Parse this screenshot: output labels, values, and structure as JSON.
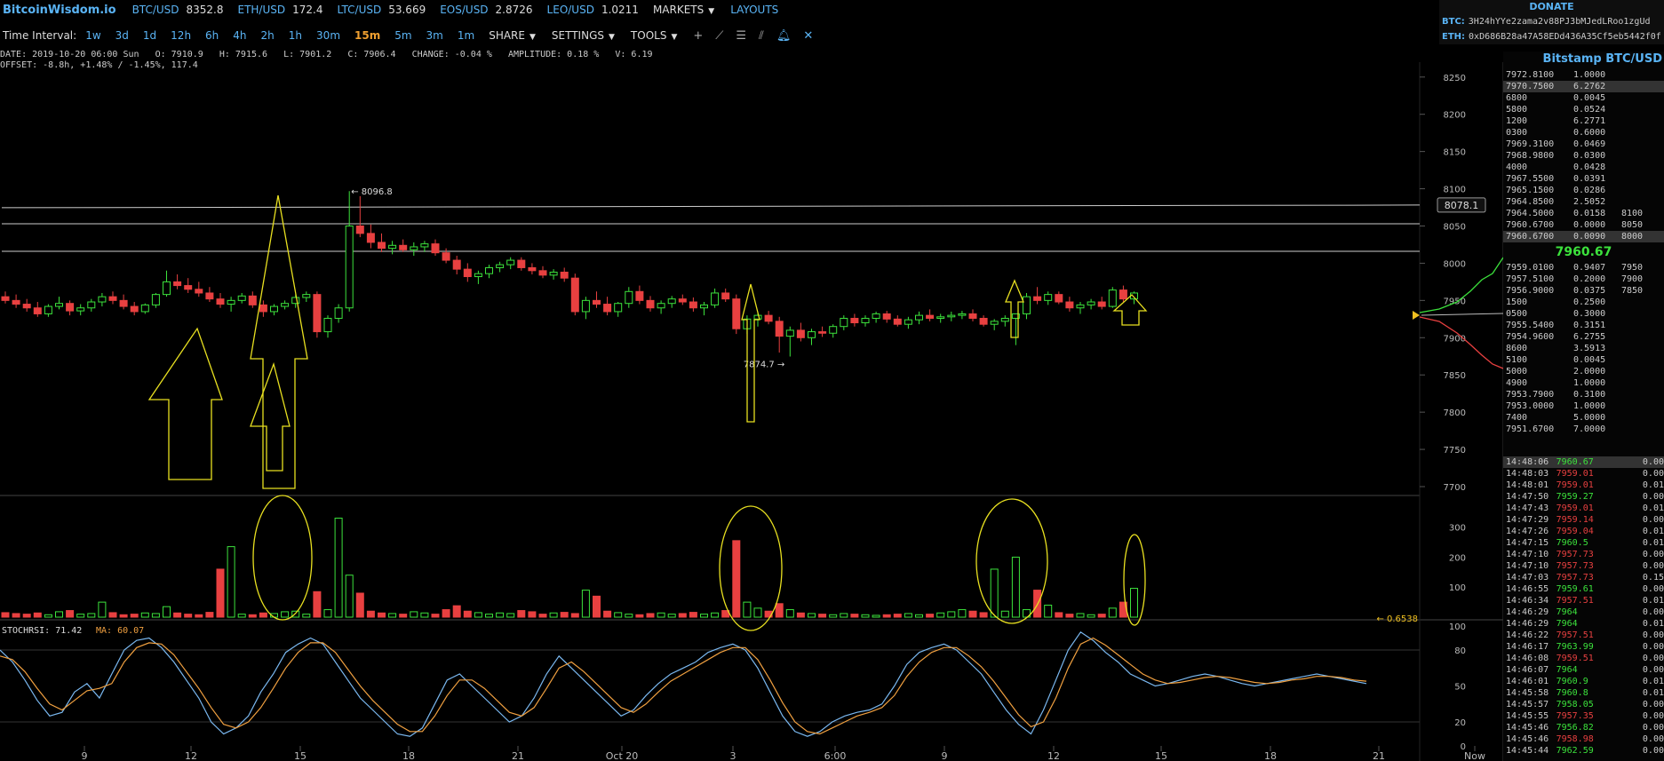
{
  "topbar": {
    "brand": "BitcoinWisdom.io",
    "tickers": [
      {
        "pair": "BTC/USD",
        "price": "8352.8"
      },
      {
        "pair": "ETH/USD",
        "price": "172.4"
      },
      {
        "pair": "LTC/USD",
        "price": "53.669"
      },
      {
        "pair": "EOS/USD",
        "price": "2.8726"
      },
      {
        "pair": "LEO/USD",
        "price": "1.0211"
      }
    ],
    "markets": "MARKETS",
    "layouts": "LAYOUTS"
  },
  "donate": {
    "title": "DONATE",
    "btc_label": "BTC:",
    "btc_addr": "3H24hYYe2zama2v88PJ3bMJedLRoo1zgUd",
    "eth_label": "ETH:",
    "eth_addr": "0xD686B28a47A58EDd436A35Cf5eb5442f0f"
  },
  "toolbar": {
    "label": "Time Interval:",
    "intervals": [
      "1w",
      "3d",
      "1d",
      "12h",
      "6h",
      "4h",
      "2h",
      "1h",
      "30m",
      "15m",
      "5m",
      "3m",
      "1m"
    ],
    "active_interval": "15m",
    "share": "SHARE",
    "settings": "SETTINGS",
    "tools": "TOOLS"
  },
  "info": {
    "line1": "DATE: 2019-10-20 06:00 Sun   O: 7910.9   H: 7915.6   L: 7901.2   C: 7906.4   CHANGE: -0.04 %   AMPLITUDE: 0.18 %   V: 6.19",
    "line2": "OFFSET: -8.8h, +1.48% / -1.45%, 117.4"
  },
  "colors": {
    "up": "#3ce23c",
    "down": "#e84040",
    "accent": "#5ab4f5",
    "annotation": "#e8e020"
  },
  "chart_data": {
    "type": "candlestick",
    "price_axis": {
      "ticks": [
        7700,
        7750,
        7800,
        7850,
        7900,
        7950,
        8000,
        8050,
        8100,
        8150,
        8200,
        8250
      ],
      "ylim": [
        7700,
        8270
      ]
    },
    "volume_axis": {
      "ticks": [
        100,
        200,
        300
      ],
      "ylim": [
        0,
        370
      ]
    },
    "stochrsi_axis": {
      "ticks": [
        0,
        20,
        50,
        80,
        100
      ],
      "ylim": [
        0,
        100
      ]
    },
    "x_ticks": [
      "9",
      "12",
      "15",
      "18",
      "21",
      "Oct 20",
      "3",
      "6:00",
      "9",
      "12",
      "15",
      "18",
      "21",
      "Now"
    ],
    "labels": {
      "high": "← 8096.8",
      "low": "7874.7 →",
      "line_price": "8078.1",
      "last_volume": "← 0.6538"
    },
    "stochrsi": {
      "label": "STOCHRSI: 71.42",
      "ma_label": "MA: 60.07"
    },
    "horizontal_lines": [
      8078.1,
      8053,
      8016
    ],
    "candles": [
      [
        7955,
        7962,
        7946,
        7950
      ],
      [
        7950,
        7958,
        7940,
        7945
      ],
      [
        7945,
        7952,
        7935,
        7940
      ],
      [
        7940,
        7948,
        7928,
        7932
      ],
      [
        7932,
        7945,
        7928,
        7942
      ],
      [
        7942,
        7955,
        7938,
        7946
      ],
      [
        7946,
        7950,
        7930,
        7936
      ],
      [
        7936,
        7945,
        7930,
        7940
      ],
      [
        7940,
        7952,
        7935,
        7948
      ],
      [
        7948,
        7960,
        7942,
        7955
      ],
      [
        7955,
        7962,
        7945,
        7950
      ],
      [
        7950,
        7958,
        7938,
        7942
      ],
      [
        7942,
        7948,
        7930,
        7935
      ],
      [
        7935,
        7946,
        7932,
        7944
      ],
      [
        7944,
        7960,
        7940,
        7958
      ],
      [
        7958,
        7990,
        7955,
        7975
      ],
      [
        7975,
        7985,
        7965,
        7970
      ],
      [
        7970,
        7980,
        7960,
        7965
      ],
      [
        7965,
        7975,
        7955,
        7960
      ],
      [
        7960,
        7968,
        7948,
        7952
      ],
      [
        7952,
        7960,
        7940,
        7945
      ],
      [
        7945,
        7955,
        7935,
        7950
      ],
      [
        7950,
        7960,
        7946,
        7956
      ],
      [
        7956,
        7962,
        7940,
        7944
      ],
      [
        7944,
        7950,
        7928,
        7935
      ],
      [
        7935,
        7945,
        7930,
        7942
      ],
      [
        7942,
        7950,
        7938,
        7946
      ],
      [
        7946,
        7958,
        7940,
        7954
      ],
      [
        7954,
        7962,
        7948,
        7958
      ],
      [
        7958,
        7962,
        7900,
        7908
      ],
      [
        7908,
        7930,
        7900,
        7926
      ],
      [
        7926,
        7945,
        7920,
        7940
      ],
      [
        7940,
        8096.8,
        7935,
        8050
      ],
      [
        8050,
        8090,
        8035,
        8040
      ],
      [
        8040,
        8052,
        8020,
        8028
      ],
      [
        8028,
        8040,
        8015,
        8020
      ],
      [
        8020,
        8030,
        8012,
        8024
      ],
      [
        8024,
        8032,
        8015,
        8018
      ],
      [
        8018,
        8028,
        8010,
        8022
      ],
      [
        8022,
        8030,
        8015,
        8026
      ],
      [
        8026,
        8032,
        8010,
        8014
      ],
      [
        8014,
        8020,
        8000,
        8004
      ],
      [
        8004,
        8010,
        7985,
        7992
      ],
      [
        7992,
        8000,
        7975,
        7982
      ],
      [
        7982,
        7990,
        7972,
        7986
      ],
      [
        7986,
        7998,
        7980,
        7994
      ],
      [
        7994,
        8002,
        7988,
        7998
      ],
      [
        7998,
        8008,
        7992,
        8004
      ],
      [
        8004,
        8008,
        7990,
        7994
      ],
      [
        7994,
        8000,
        7985,
        7990
      ],
      [
        7990,
        7996,
        7980,
        7984
      ],
      [
        7984,
        7992,
        7978,
        7988
      ],
      [
        7988,
        7994,
        7975,
        7980
      ],
      [
        7980,
        7986,
        7930,
        7935
      ],
      [
        7935,
        7955,
        7925,
        7950
      ],
      [
        7950,
        7962,
        7940,
        7945
      ],
      [
        7945,
        7955,
        7930,
        7935
      ],
      [
        7935,
        7948,
        7928,
        7946
      ],
      [
        7946,
        7968,
        7940,
        7962
      ],
      [
        7962,
        7970,
        7945,
        7950
      ],
      [
        7950,
        7956,
        7935,
        7940
      ],
      [
        7940,
        7950,
        7932,
        7946
      ],
      [
        7946,
        7956,
        7940,
        7952
      ],
      [
        7952,
        7958,
        7944,
        7948
      ],
      [
        7948,
        7954,
        7935,
        7940
      ],
      [
        7940,
        7948,
        7930,
        7944
      ],
      [
        7944,
        7966,
        7940,
        7960
      ],
      [
        7960,
        7966,
        7948,
        7952
      ],
      [
        7952,
        7958,
        7905,
        7912
      ],
      [
        7912,
        7930,
        7905,
        7925
      ],
      [
        7925,
        7935,
        7915,
        7930
      ],
      [
        7930,
        7936,
        7918,
        7922
      ],
      [
        7922,
        7928,
        7880,
        7902
      ],
      [
        7902,
        7915,
        7874.7,
        7910
      ],
      [
        7910,
        7920,
        7895,
        7900
      ],
      [
        7900,
        7912,
        7890,
        7908
      ],
      [
        7908,
        7915,
        7901,
        7906
      ],
      [
        7906,
        7918,
        7900,
        7915
      ],
      [
        7915,
        7930,
        7910,
        7926
      ],
      [
        7926,
        7932,
        7915,
        7920
      ],
      [
        7920,
        7930,
        7915,
        7926
      ],
      [
        7926,
        7935,
        7920,
        7932
      ],
      [
        7932,
        7936,
        7920,
        7925
      ],
      [
        7925,
        7930,
        7915,
        7918
      ],
      [
        7918,
        7928,
        7912,
        7924
      ],
      [
        7924,
        7935,
        7918,
        7930
      ],
      [
        7930,
        7938,
        7922,
        7926
      ],
      [
        7926,
        7932,
        7920,
        7928
      ],
      [
        7928,
        7935,
        7922,
        7930
      ],
      [
        7930,
        7936,
        7925,
        7932
      ],
      [
        7932,
        7938,
        7922,
        7926
      ],
      [
        7926,
        7930,
        7915,
        7918
      ],
      [
        7918,
        7925,
        7910,
        7922
      ],
      [
        7922,
        7930,
        7915,
        7926
      ],
      [
        7926,
        7932,
        7890,
        7932
      ],
      [
        7932,
        7960,
        7925,
        7955
      ],
      [
        7955,
        7968,
        7945,
        7950
      ],
      [
        7950,
        7962,
        7944,
        7958
      ],
      [
        7958,
        7962,
        7945,
        7948
      ],
      [
        7948,
        7955,
        7935,
        7940
      ],
      [
        7940,
        7948,
        7932,
        7944
      ],
      [
        7944,
        7952,
        7938,
        7948
      ],
      [
        7948,
        7955,
        7938,
        7942
      ],
      [
        7942,
        7968,
        7940,
        7964
      ],
      [
        7964,
        7970,
        7948,
        7952
      ],
      [
        7952,
        7962,
        7945,
        7960
      ]
    ],
    "volumes": [
      15,
      12,
      10,
      14,
      8,
      18,
      22,
      10,
      12,
      50,
      15,
      8,
      10,
      14,
      12,
      35,
      14,
      10,
      8,
      16,
      160,
      235,
      10,
      8,
      14,
      12,
      18,
      20,
      10,
      85,
      25,
      330,
      140,
      80,
      20,
      14,
      12,
      10,
      18,
      14,
      10,
      25,
      38,
      20,
      15,
      10,
      14,
      12,
      22,
      18,
      10,
      14,
      16,
      12,
      90,
      70,
      20,
      15,
      10,
      8,
      12,
      14,
      10,
      12,
      16,
      10,
      14,
      22,
      255,
      50,
      30,
      20,
      45,
      25,
      14,
      12,
      10,
      8,
      12,
      10,
      8,
      6,
      8,
      10,
      12,
      8,
      10,
      14,
      18,
      25,
      20,
      15,
      160,
      20,
      200,
      25,
      90,
      40,
      15,
      10,
      12,
      8,
      10,
      30,
      50,
      96
    ],
    "stochrsi_k": [
      80,
      70,
      55,
      38,
      25,
      28,
      45,
      52,
      40,
      60,
      80,
      88,
      90,
      82,
      70,
      55,
      40,
      20,
      10,
      15,
      25,
      45,
      60,
      78,
      85,
      90,
      85,
      70,
      55,
      40,
      30,
      20,
      10,
      8,
      15,
      35,
      55,
      60,
      50,
      40,
      30,
      20,
      25,
      40,
      60,
      75,
      65,
      55,
      45,
      35,
      25,
      30,
      42,
      52,
      60,
      65,
      70,
      78,
      82,
      85,
      80,
      65,
      45,
      25,
      12,
      8,
      12,
      20,
      25,
      28,
      30,
      35,
      50,
      68,
      78,
      82,
      85,
      80,
      70,
      60,
      45,
      30,
      18,
      10,
      30,
      55,
      80,
      95,
      88,
      78,
      70,
      60,
      55,
      50,
      52,
      55,
      58,
      60,
      58,
      55,
      52,
      50,
      52,
      54,
      56,
      58,
      60,
      58,
      56,
      54,
      52
    ],
    "stochrsi_d": [
      75,
      72,
      62,
      48,
      35,
      30,
      38,
      46,
      48,
      52,
      70,
      82,
      86,
      85,
      76,
      62,
      48,
      32,
      18,
      15,
      20,
      32,
      48,
      65,
      78,
      86,
      86,
      78,
      64,
      50,
      38,
      28,
      18,
      12,
      12,
      25,
      42,
      55,
      55,
      48,
      38,
      28,
      25,
      32,
      48,
      65,
      70,
      62,
      52,
      42,
      32,
      28,
      35,
      45,
      54,
      60,
      66,
      72,
      78,
      82,
      82,
      72,
      55,
      36,
      20,
      12,
      10,
      15,
      20,
      25,
      28,
      32,
      42,
      58,
      70,
      78,
      82,
      82,
      75,
      66,
      54,
      40,
      26,
      16,
      20,
      40,
      65,
      85,
      90,
      84,
      76,
      68,
      60,
      55,
      52,
      53,
      55,
      57,
      58,
      57,
      55,
      53,
      52,
      53,
      55,
      56,
      58,
      58,
      57,
      55,
      54
    ]
  },
  "orderbook": {
    "title": "Bitstamp BTC/USD",
    "asks": [
      {
        "price": "7972.81",
        "suffix": "00",
        "amount": "1.0000"
      },
      {
        "price": "7970.75",
        "suffix": "00",
        "amount": "6.2762",
        "hl": true
      },
      {
        "price": "68",
        "suffix": "00",
        "amount": "0.0045"
      },
      {
        "price": "58",
        "suffix": "00",
        "amount": "0.0524"
      },
      {
        "price": "12",
        "suffix": "00",
        "amount": "6.2771"
      },
      {
        "price": "03",
        "suffix": "00",
        "amount": "0.6000"
      },
      {
        "price": "7969.31",
        "suffix": "00",
        "amount": "0.0469"
      },
      {
        "price": "7968.98",
        "suffix": "00",
        "amount": "0.0300"
      },
      {
        "price": "4",
        "suffix": "000",
        "amount": "0.0428"
      },
      {
        "price": "7967.55",
        "suffix": "00",
        "amount": "0.0391"
      },
      {
        "price": "7965.15",
        "suffix": "00",
        "amount": "0.0286"
      },
      {
        "price": "7964.85",
        "suffix": "00",
        "amount": "2.5052"
      },
      {
        "price": "7964.5",
        "suffix": "000",
        "amount": "0.0158",
        "axis": "8100"
      },
      {
        "price": "7960.67",
        "suffix": "00",
        "amount": "0.0000",
        "axis": "8050"
      },
      {
        "price": "7960.67",
        "suffix": "00",
        "amount": "0.0090",
        "axis": "8000",
        "hl": true
      }
    ],
    "mid": "7960.67",
    "bids": [
      {
        "price": "7959.01",
        "suffix": "00",
        "amount": "0.9407",
        "axis": "7950"
      },
      {
        "price": "7957.51",
        "suffix": "00",
        "amount": "0.2000",
        "axis": "7900"
      },
      {
        "price": "7956.9",
        "suffix": "000",
        "amount": "0.0375",
        "axis": "7850"
      },
      {
        "price": "15",
        "suffix": "00",
        "amount": "0.2500"
      },
      {
        "price": "05",
        "suffix": "00",
        "amount": "0.3000"
      },
      {
        "price": "7955.54",
        "suffix": "00",
        "amount": "0.3151"
      },
      {
        "price": "7954.96",
        "suffix": "00",
        "amount": "6.2755"
      },
      {
        "price": "86",
        "suffix": "00",
        "amount": "3.5913"
      },
      {
        "price": "51",
        "suffix": "00",
        "amount": "0.0045"
      },
      {
        "price": "50",
        "suffix": "00",
        "amount": "2.0000"
      },
      {
        "price": "49",
        "suffix": "00",
        "amount": "1.0000"
      },
      {
        "price": "7953.79",
        "suffix": "00",
        "amount": "0.3100"
      },
      {
        "price": "7953.00",
        "suffix": "00",
        "amount": "1.0000"
      },
      {
        "price": "74",
        "suffix": "00",
        "amount": "5.0000"
      },
      {
        "price": "7951.67",
        "suffix": "00",
        "amount": "7.0000"
      }
    ]
  },
  "trades": [
    {
      "time": "14:48:06",
      "price": "7960.67",
      "amount": "0.00",
      "dir": "up",
      "hl": true
    },
    {
      "time": "14:48:03",
      "price": "7959.01",
      "amount": "0.00",
      "dir": "dn"
    },
    {
      "time": "14:48:01",
      "price": "7959.01",
      "amount": "0.01",
      "dir": "dn"
    },
    {
      "time": "14:47:50",
      "price": "7959.27",
      "amount": "0.00",
      "dir": "up"
    },
    {
      "time": "14:47:43",
      "price": "7959.01",
      "amount": "0.01",
      "dir": "dn"
    },
    {
      "time": "14:47:29",
      "price": "7959.14",
      "amount": "0.00",
      "dir": "dn"
    },
    {
      "time": "14:47:26",
      "price": "7959.04",
      "amount": "0.01",
      "dir": "dn"
    },
    {
      "time": "14:47:15",
      "price": "7960.5",
      "amount": "0.01",
      "dir": "up"
    },
    {
      "time": "14:47:10",
      "price": "7957.73",
      "amount": "0.00",
      "dir": "dn"
    },
    {
      "time": "14:47:10",
      "price": "7957.73",
      "amount": "0.00",
      "dir": "dn"
    },
    {
      "time": "14:47:03",
      "price": "7957.73",
      "amount": "0.15",
      "dir": "dn"
    },
    {
      "time": "14:46:55",
      "price": "7959.61",
      "amount": "0.00",
      "dir": "up"
    },
    {
      "time": "14:46:34",
      "price": "7957.51",
      "amount": "0.01",
      "dir": "dn"
    },
    {
      "time": "14:46:29",
      "price": "7964",
      "amount": "0.00",
      "dir": "up"
    },
    {
      "time": "14:46:29",
      "price": "7964",
      "amount": "0.01",
      "dir": "up"
    },
    {
      "time": "14:46:22",
      "price": "7957.51",
      "amount": "0.00",
      "dir": "dn"
    },
    {
      "time": "14:46:17",
      "price": "7963.99",
      "amount": "0.00",
      "dir": "up"
    },
    {
      "time": "14:46:08",
      "price": "7959.51",
      "amount": "0.00",
      "dir": "dn"
    },
    {
      "time": "14:46:07",
      "price": "7964",
      "amount": "0.00",
      "dir": "up"
    },
    {
      "time": "14:46:01",
      "price": "7960.9",
      "amount": "0.01",
      "dir": "up"
    },
    {
      "time": "14:45:58",
      "price": "7960.8",
      "amount": "0.01",
      "dir": "up"
    },
    {
      "time": "14:45:57",
      "price": "7958.05",
      "amount": "0.00",
      "dir": "up"
    },
    {
      "time": "14:45:55",
      "price": "7957.35",
      "amount": "0.00",
      "dir": "dn"
    },
    {
      "time": "14:45:46",
      "price": "7956.82",
      "amount": "0.00",
      "dir": "up"
    },
    {
      "time": "14:45:46",
      "price": "7958.98",
      "amount": "0.00",
      "dir": "dn"
    },
    {
      "time": "14:45:44",
      "price": "7962.59",
      "amount": "0.00",
      "dir": "up"
    }
  ]
}
